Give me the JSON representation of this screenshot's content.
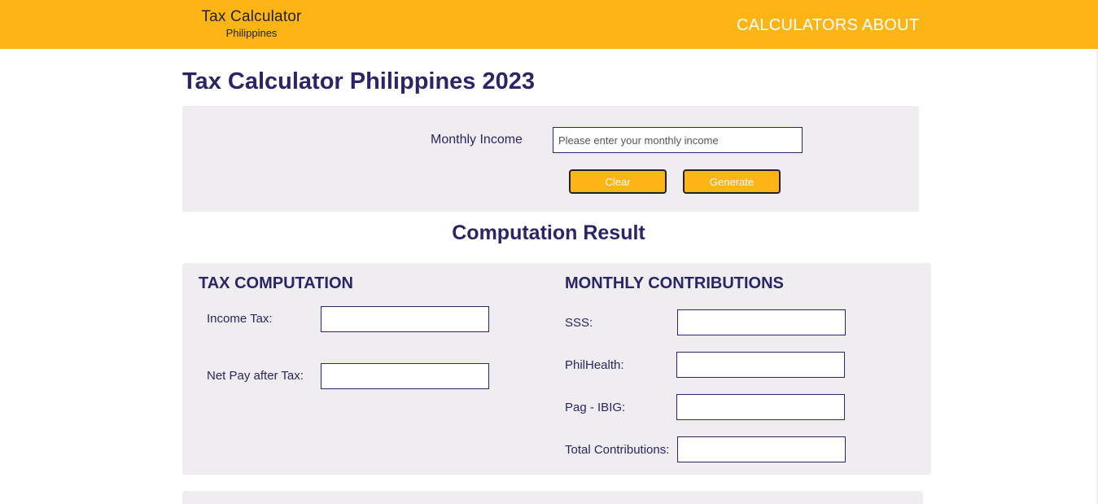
{
  "header": {
    "brand_title": "Tax Calculator",
    "brand_subtitle": "Philippines",
    "nav": [
      "CALCULATORS",
      "ABOUT"
    ],
    "accent_color": "#fdb515"
  },
  "page_title": "Tax Calculator Philippines 2023",
  "input_form": {
    "income_label": "Monthly Income",
    "income_placeholder": "Please enter your monthly income",
    "income_value": "",
    "clear_label": "Clear",
    "generate_label": "Generate"
  },
  "result_title": "Computation Result",
  "tax_computation": {
    "heading": "TAX COMPUTATION",
    "income_tax_label": "Income Tax:",
    "income_tax_value": "",
    "net_pay_label": "Net Pay after Tax:",
    "net_pay_value": ""
  },
  "monthly_contributions": {
    "heading": "MONTHLY CONTRIBUTIONS",
    "sss_label": "SSS:",
    "sss_value": "",
    "philhealth_label": "PhilHealth:",
    "philhealth_value": "",
    "pagibig_label": "Pag - IBIG:",
    "pagibig_value": "",
    "total_label": "Total Contributions:",
    "total_value": ""
  }
}
